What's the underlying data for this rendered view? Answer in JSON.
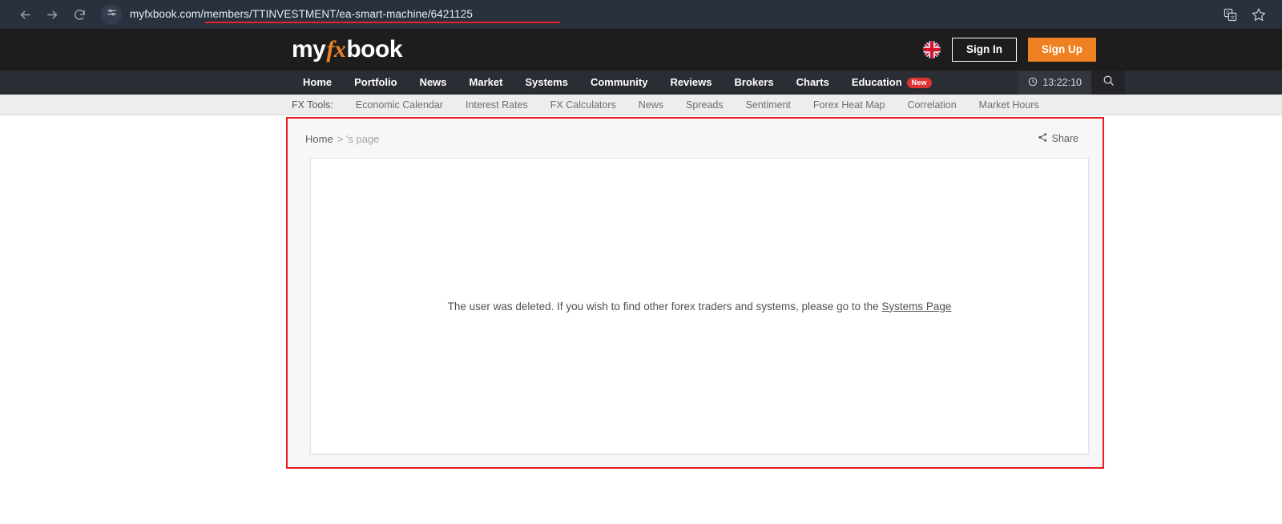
{
  "browser": {
    "back_icon": "back-arrow-icon",
    "forward_icon": "forward-arrow-icon",
    "reload_icon": "reload-icon",
    "site_settings_icon": "site-settings-icon",
    "url": "myfxbook.com/members/TTINVESTMENT/ea-smart-machine/6421125",
    "url_placeholder": "Search Google or type a URL",
    "translate_icon": "translate-icon",
    "bookmark_icon": "star-icon",
    "highlight_color": "#e8212a"
  },
  "header": {
    "logo": {
      "part1": "my",
      "part2": "fx",
      "part3": "book"
    },
    "language_flag": "uk-flag-icon",
    "sign_in_label": "Sign In",
    "sign_up_label": "Sign Up",
    "accent_color": "#f08122"
  },
  "main_nav": {
    "items": [
      {
        "label": "Home"
      },
      {
        "label": "Portfolio"
      },
      {
        "label": "News"
      },
      {
        "label": "Market"
      },
      {
        "label": "Systems"
      },
      {
        "label": "Community"
      },
      {
        "label": "Reviews"
      },
      {
        "label": "Brokers"
      },
      {
        "label": "Charts"
      },
      {
        "label": "Education",
        "badge": "New"
      }
    ],
    "clock_icon": "clock-icon",
    "clock_time": "13:22:10",
    "search_icon": "search-icon"
  },
  "sub_nav": {
    "label": "FX Tools:",
    "items": [
      {
        "label": "Economic Calendar"
      },
      {
        "label": "Interest Rates"
      },
      {
        "label": "FX Calculators"
      },
      {
        "label": "News"
      },
      {
        "label": "Spreads"
      },
      {
        "label": "Sentiment"
      },
      {
        "label": "Forex Heat Map"
      },
      {
        "label": "Correlation"
      },
      {
        "label": "Market Hours"
      }
    ]
  },
  "content": {
    "breadcrumb_home": "Home",
    "breadcrumb_rest": "> 's page",
    "share_icon": "share-icon",
    "share_label": "Share",
    "message_text": "The user was deleted. If you wish to find other forex traders and systems, please go to the ",
    "message_link": "Systems Page"
  }
}
